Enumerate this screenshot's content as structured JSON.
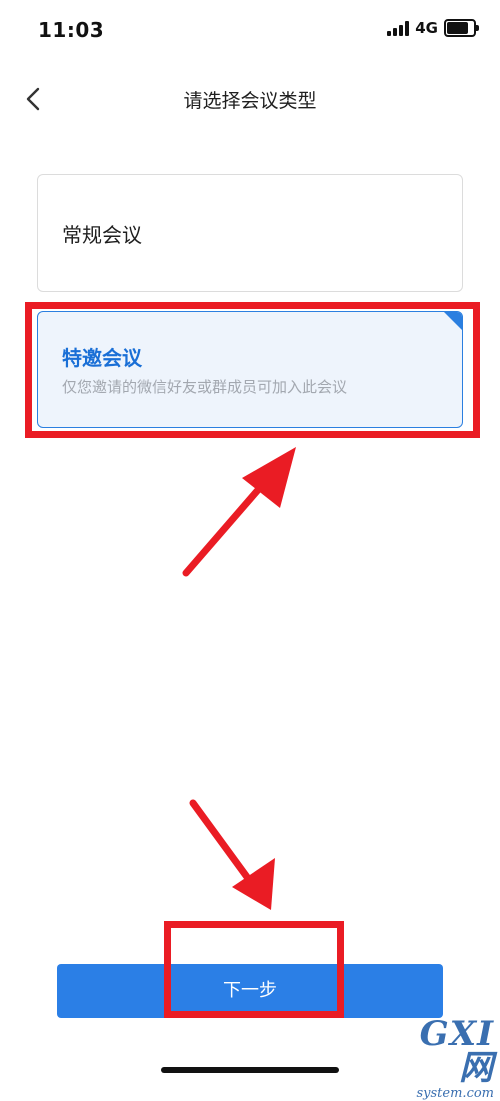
{
  "status_bar": {
    "time": "11:03",
    "network": "4G",
    "icons": [
      "signal-icon",
      "battery-icon"
    ]
  },
  "nav": {
    "back_icon": "chevron-left-icon",
    "title": "请选择会议类型"
  },
  "options": [
    {
      "title": "常规会议",
      "description": "",
      "selected": false
    },
    {
      "title": "特邀会议",
      "description": "仅您邀请的微信好友或群成员可加入此会议",
      "selected": true
    }
  ],
  "next_button": {
    "label": "下一步"
  },
  "watermark": {
    "main": "GXI网",
    "sub": "system.com"
  },
  "colors": {
    "accent": "#2b7fe6",
    "selected_title": "#1a6fd6",
    "selected_bg": "#eef4fc",
    "annotation": "#ea1c24",
    "description": "#a3a8b0"
  }
}
